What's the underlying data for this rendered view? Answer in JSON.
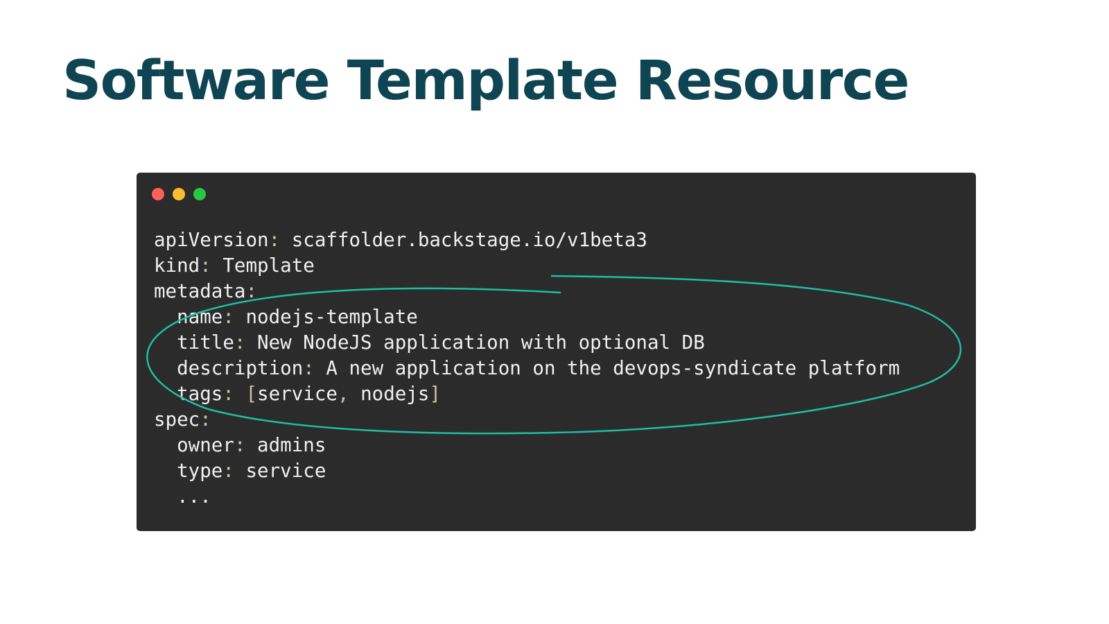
{
  "slide": {
    "title": "Software Template Resource"
  },
  "code_window": {
    "traffic_lights": [
      {
        "name": "close-dot",
        "color": "#ff5f57"
      },
      {
        "name": "minimize-dot",
        "color": "#febc2e"
      },
      {
        "name": "maximize-dot",
        "color": "#28c840"
      }
    ],
    "lines": [
      {
        "indent": "",
        "key": "apiVersion",
        "sep": ": ",
        "value": "scaffolder.backstage.io/v1beta3"
      },
      {
        "indent": "",
        "key": "kind",
        "sep": ": ",
        "value": "Template"
      },
      {
        "indent": "",
        "key": "metadata",
        "sep": ":",
        "value": ""
      },
      {
        "indent": "  ",
        "key": "name",
        "sep": ": ",
        "value": "nodejs-template"
      },
      {
        "indent": "  ",
        "key": "title",
        "sep": ": ",
        "value": "New NodeJS application with optional DB"
      },
      {
        "indent": "  ",
        "key": "description",
        "sep": ": ",
        "value": "A new application on the devops-syndicate platform"
      },
      {
        "indent": "  ",
        "key": "tags",
        "sep": ": ",
        "value": "",
        "open_bracket": "[",
        "items_text": "service",
        "comma": ", ",
        "items_text_2": "nodejs",
        "close_bracket": "]"
      },
      {
        "indent": "",
        "key": "spec",
        "sep": ":",
        "value": ""
      },
      {
        "indent": "  ",
        "key": "owner",
        "sep": ": ",
        "value": "admins"
      },
      {
        "indent": "  ",
        "key": "type",
        "sep": ": ",
        "value": "service"
      },
      {
        "indent": "  ",
        "key": "...",
        "sep": "",
        "value": ""
      }
    ],
    "colors": {
      "background": "#2b2b2b",
      "text": "#f0f0f0",
      "punctuation": "#c9c3a6",
      "annotation": "#1fbfa0"
    }
  }
}
